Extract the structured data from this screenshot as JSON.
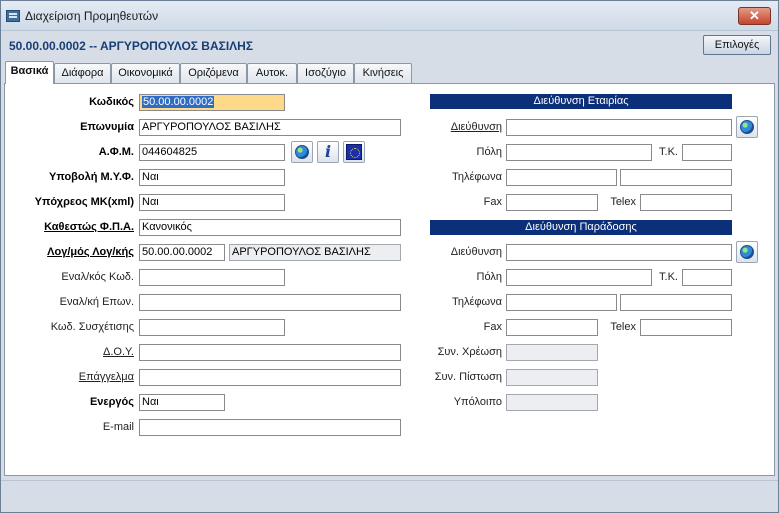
{
  "window": {
    "title": "Διαχείριση Προμηθευτών",
    "close_glyph": "✕"
  },
  "header": {
    "record_title": "50.00.00.0002 -- ΑΡΓΥΡΟΠΟΥΛΟΣ ΒΑΣΙΛΗΣ",
    "options_label": "Επιλογές"
  },
  "tabs": [
    {
      "label": "Βασικά",
      "active": true
    },
    {
      "label": "Διάφορα"
    },
    {
      "label": "Οικονομικά"
    },
    {
      "label": "Οριζόμενα"
    },
    {
      "label": "Αυτοκ."
    },
    {
      "label": "Ισοζύγιο"
    },
    {
      "label": "Κινήσεις"
    }
  ],
  "left": {
    "code": {
      "label": "Κωδικός",
      "value": "50.00.00.0002"
    },
    "name": {
      "label": "Επωνυμία",
      "value": "ΑΡΓΥΡΟΠΟΥΛΟΣ ΒΑΣΙΛΗΣ"
    },
    "afm": {
      "label": "Α.Φ.Μ.",
      "value": "044604825"
    },
    "myf": {
      "label": "Υποβολή Μ.Υ.Φ.",
      "value": "Ναι"
    },
    "mk": {
      "label": "Υπόχρεος ΜΚ(xml)",
      "value": "Ναι"
    },
    "vat": {
      "label": "Καθεστώς Φ.Π.Α.",
      "value": "Κανονικός"
    },
    "account": {
      "label": "Λογ/μός Λογ/κής",
      "code": "50.00.00.0002",
      "name": "ΑΡΓΥΡΟΠΟΥΛΟΣ ΒΑΣΙΛΗΣ"
    },
    "alt_code": {
      "label": "Εναλ/κός Κωδ.",
      "value": ""
    },
    "alt_name": {
      "label": "Εναλ/κή Επων.",
      "value": ""
    },
    "rel_code": {
      "label": "Κωδ. Συσχέτισης",
      "value": ""
    },
    "doy": {
      "label": "Δ.Ο.Υ.",
      "value": ""
    },
    "profession": {
      "label": "Επάγγελμα",
      "value": ""
    },
    "active": {
      "label": "Ενεργός",
      "value": "Ναι"
    },
    "email": {
      "label": "E-mail",
      "value": ""
    }
  },
  "right": {
    "company_address": {
      "header": "Διεύθυνση Εταιρίας",
      "address_label": "Διεύθυνση",
      "address": "",
      "city_label": "Πόλη",
      "city": "",
      "zip_label": "Τ.Κ.",
      "zip": "",
      "phones_label": "Τηλέφωνα",
      "phone1": "",
      "phone2": "",
      "fax_label": "Fax",
      "fax": "",
      "telex_label": "Telex",
      "telex": ""
    },
    "delivery_address": {
      "header": "Διεύθυνση Παράδοσης",
      "address_label": "Διεύθυνση",
      "address": "",
      "city_label": "Πόλη",
      "city": "",
      "zip_label": "Τ.Κ.",
      "zip": "",
      "phones_label": "Τηλέφωνα",
      "phone1": "",
      "phone2": "",
      "fax_label": "Fax",
      "fax": "",
      "telex_label": "Telex",
      "telex": ""
    },
    "balances": {
      "debit_label": "Συν. Χρέωση",
      "debit": "",
      "credit_label": "Συν. Πίστωση",
      "credit": "",
      "balance_label": "Υπόλοιπο",
      "balance": ""
    }
  },
  "icons": {
    "globe": "globe-icon",
    "info": "info-icon",
    "eu": "eu-flag-icon",
    "info_glyph": "i"
  }
}
